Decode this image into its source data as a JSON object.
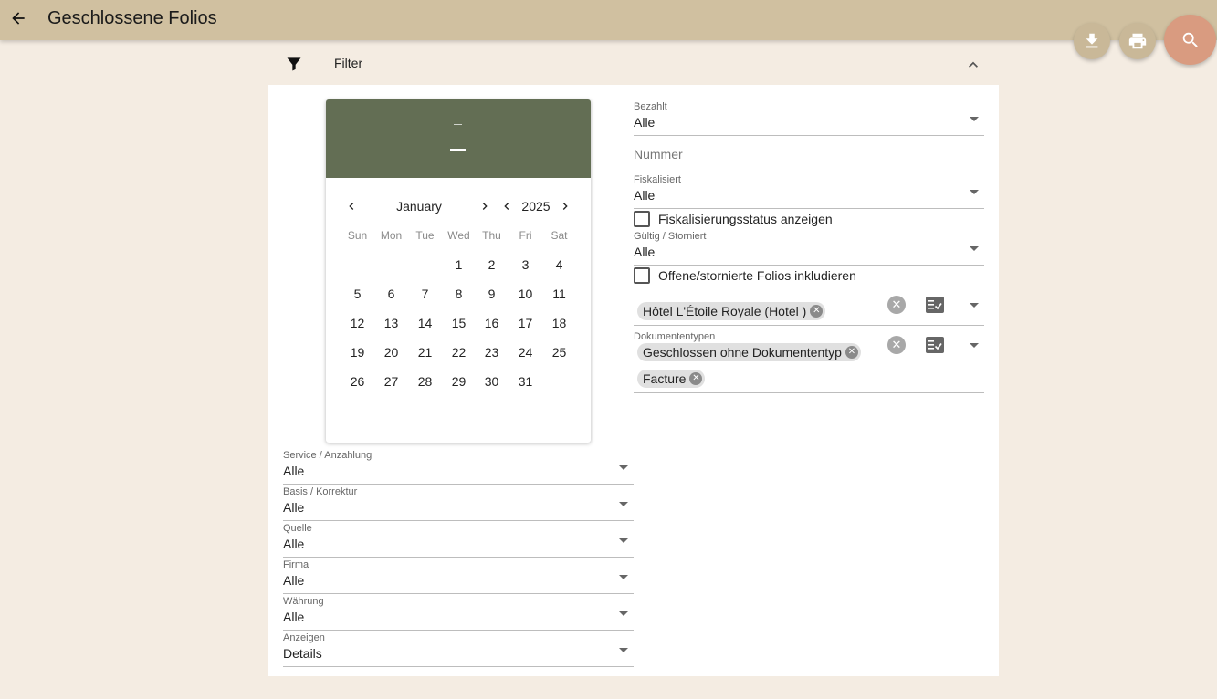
{
  "header": {
    "title": "Geschlossene Folios"
  },
  "icons": {
    "back": "arrow-back-icon",
    "download": "download-icon",
    "print": "print-icon",
    "search": "search-icon",
    "filter": "filter-icon",
    "collapse": "chevron-up-icon"
  },
  "colors": {
    "topbar": "#d0c0a0",
    "background": "#f4ece2",
    "calendar_header": "#636e54",
    "search_fab": "#d99b80"
  },
  "filter": {
    "label": "Filter"
  },
  "calendar": {
    "month": "January",
    "year": "2025",
    "weekdays": [
      "Sun",
      "Mon",
      "Tue",
      "Wed",
      "Thu",
      "Fri",
      "Sat"
    ],
    "first_weekday_index": 3,
    "days_in_month": 31
  },
  "left_fields": [
    {
      "label": "Service / Anzahlung",
      "value": "Alle"
    },
    {
      "label": "Basis / Korrektur",
      "value": "Alle"
    },
    {
      "label": "Quelle",
      "value": "Alle"
    },
    {
      "label": "Firma",
      "value": "Alle"
    },
    {
      "label": "Währung",
      "value": "Alle"
    },
    {
      "label": "Anzeigen",
      "value": "Details"
    }
  ],
  "right": {
    "bezahlt": {
      "label": "Bezahlt",
      "value": "Alle"
    },
    "nummer": {
      "placeholder": "Nummer"
    },
    "fiskalisiert": {
      "label": "Fiskalisiert",
      "value": "Alle"
    },
    "fisk_checkbox": {
      "label": "Fiskalisierungsstatus anzeigen",
      "checked": false
    },
    "gueltig": {
      "label": "Gültig / Storniert",
      "value": "Alle"
    },
    "offene_checkbox": {
      "label": "Offene/stornierte Folios inkludieren",
      "checked": false
    },
    "hotel": {
      "chips": [
        "Hôtel L'Étoile Royale (Hotel )"
      ]
    },
    "dokumententypen": {
      "label": "Dokumententypen",
      "chips": [
        "Geschlossen ohne Dokumententyp",
        "Facture"
      ]
    }
  }
}
